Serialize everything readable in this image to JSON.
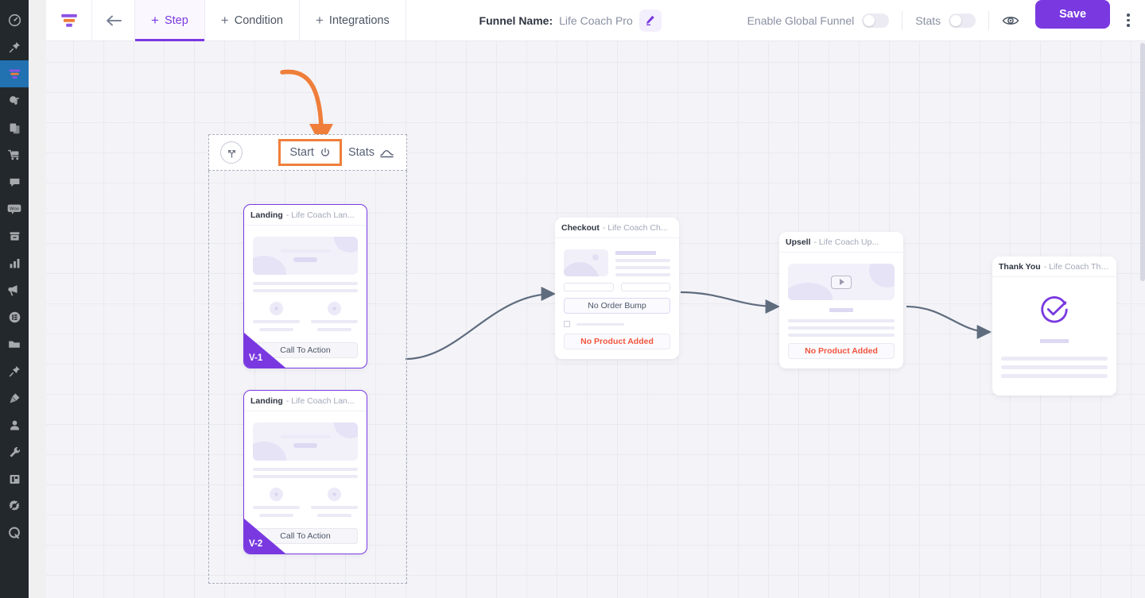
{
  "app": {
    "logo_icon": "funnel-logo-icon",
    "brand_color": "#7a39e0",
    "accent_orange": "#ef7e3a",
    "danger_color": "#f4553d"
  },
  "sidebar": {
    "items": [
      {
        "name": "dashboard",
        "icon": "gauge-icon",
        "active": false
      },
      {
        "name": "pin",
        "icon": "pin-icon",
        "active": false
      },
      {
        "name": "funnels",
        "icon": "funnel-icon",
        "active": true
      },
      {
        "name": "media",
        "icon": "media-note-icon",
        "active": false
      },
      {
        "name": "pages",
        "icon": "pages-copy-icon",
        "active": false
      },
      {
        "name": "store",
        "icon": "shopping-cart-icon",
        "active": false
      },
      {
        "name": "comments",
        "icon": "comment-bubble-icon",
        "active": false
      },
      {
        "name": "woocommerce",
        "icon": "woo-icon",
        "active": false
      },
      {
        "name": "archive",
        "icon": "archive-box-icon",
        "active": false
      },
      {
        "name": "analytics",
        "icon": "bar-chart-icon",
        "active": false
      },
      {
        "name": "marketing",
        "icon": "megaphone-icon",
        "active": false
      },
      {
        "name": "elementor",
        "icon": "elementor-icon",
        "active": false
      },
      {
        "name": "folder",
        "icon": "folder-icon",
        "active": false
      },
      {
        "name": "pin-2",
        "icon": "pushpin-icon",
        "active": false
      },
      {
        "name": "plugins",
        "icon": "plug-icon",
        "active": false
      },
      {
        "name": "users",
        "icon": "user-icon",
        "active": false
      },
      {
        "name": "tools",
        "icon": "wrench-icon",
        "active": false
      },
      {
        "name": "addons",
        "icon": "addon-box-icon",
        "active": false
      },
      {
        "name": "settings",
        "icon": "gear-slash-icon",
        "active": false
      },
      {
        "name": "quick",
        "icon": "q-letter-icon",
        "active": false
      }
    ]
  },
  "topbar": {
    "back_icon": "arrow-left-icon",
    "tabs": [
      {
        "label": "Step",
        "icon": "plus-icon",
        "active": true
      },
      {
        "label": "Condition",
        "icon": "plus-icon",
        "active": false
      },
      {
        "label": "Integrations",
        "icon": "plus-icon",
        "active": false
      }
    ],
    "funnel_name_label": "Funnel Name:",
    "funnel_name_value": "Life Coach Pro",
    "edit_icon": "pencil-icon",
    "global_funnel_label": "Enable Global Funnel",
    "global_funnel_on": false,
    "stats_label": "Stats",
    "stats_on": false,
    "preview_icon": "eye-icon",
    "save_label": "Save",
    "more_icon": "kebab-menu-icon"
  },
  "canvas": {
    "group": {
      "split_icon": "split-branch-icon",
      "start_label": "Start",
      "start_icon": "power-icon",
      "start_highlighted": true,
      "stats_label": "Stats",
      "stats_icon": "chart-line-icon"
    },
    "nodes": [
      {
        "id": "landing-v1",
        "type": "Landing",
        "page_name": "- Life Coach Lan...",
        "cta_label": "Call To Action",
        "variant_badge": "V-1"
      },
      {
        "id": "landing-v2",
        "type": "Landing",
        "page_name": "- Life Coach Lan...",
        "cta_label": "Call To Action",
        "variant_badge": "V-2"
      },
      {
        "id": "checkout",
        "type": "Checkout",
        "page_name": "- Life Coach Ch...",
        "order_bump_label": "No Order Bump",
        "no_product_label": "No Product Added"
      },
      {
        "id": "upsell",
        "type": "Upsell",
        "page_name": "- Life Coach Up...",
        "play_icon": "play-button-icon",
        "no_product_label": "No Product Added"
      },
      {
        "id": "thankyou",
        "type": "Thank You",
        "page_name": "- Life Coach Tha...",
        "success_icon": "check-circle-icon"
      }
    ],
    "entry_arrow_icon": "curved-arrow-down-icon"
  }
}
